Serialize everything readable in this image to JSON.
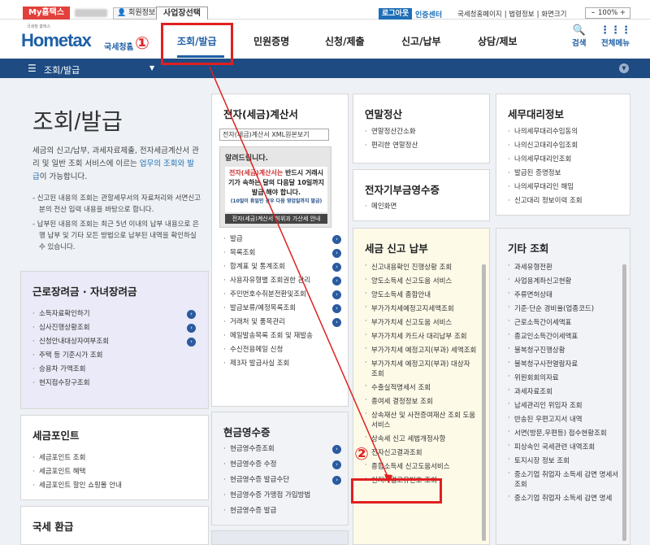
{
  "topbar": {
    "my_hometax": "My홈택스",
    "member_info": "회원정보",
    "business_select": "사업장선택",
    "logout": "로그아웃",
    "cert_center": "인증센터",
    "links": [
      "국세청홈페이지",
      "법령정보",
      "화면크기"
    ],
    "zoom": "100%"
  },
  "header": {
    "logo_sub": "국세청 홈택스",
    "logo": "Hometax",
    "agency": "국세청홈택스",
    "nav": [
      "조회/발급",
      "민원증명",
      "신청/제출",
      "신고/납부",
      "상담/제보"
    ],
    "search": "검색",
    "allmenu": "전체메뉴"
  },
  "breadcrumb": {
    "title": "조회/발급"
  },
  "intro": {
    "title": "조회/발급",
    "desc_pre": "세금의 신고/납부, 과세자료제출, 전자세금계산서 관리 및 일반 조회 서비스에 이르는 ",
    "desc_hl": "업무의 조회와 발급",
    "desc_post": "이 가능합니다.",
    "notes": [
      "- 신고된 내용의 조회는 관할세무서의 자료처리와 서면신고분의 전산 입력 내용을 바탕으로 합니다.",
      "- 납부된 내용의 조회는 최근 5년 이내의 납부 내용으로 은행 납부 및 기타 모든 방법으로 납부된 내역을 확인하실 수 있습니다."
    ]
  },
  "boxes": {
    "labor": {
      "title": "근로장려금 · 자녀장려금",
      "items": [
        "소득자료확인하기",
        "심사진행상황조회",
        "신청안내대상자여부조회",
        "주택 등 기준시가 조회",
        "승용차 가액조회",
        "현지접수장구조회"
      ]
    },
    "point": {
      "title": "세금포인트",
      "items": [
        "세금포인트 조회",
        "세금포인트 혜택",
        "세금포인트 할인 쇼핑몰 안내"
      ]
    },
    "refund": {
      "title": "국세 환급"
    },
    "einvoice": {
      "title": "전자(세금)계산서",
      "xml": "전자(세금)계산서 XML원본보기",
      "notice_title": "알려드립니다.",
      "notice_body_1": "전자(세금)계산서는",
      "notice_body_2": "반드시 거래시기가 속하는 달의 다음달 10일까지 발급 해야 합니다.",
      "notice_small": "(10일이 휴일인 경우 다음 영업일까지 발급)",
      "notice_bar": "전자(세금)계산서 허위과 가산세 안내",
      "items": [
        "발급",
        "목록조회",
        "합계표 및 통계조회",
        "사용자유형별 조회권한 관리",
        "주민번호수취분전환및조회",
        "발급보류/예정목록조회",
        "거래처 및 품목관리",
        "메일발송목록 조회 및 재발송",
        "수신전용메일 신청",
        "제3자 발급사실 조회"
      ]
    },
    "cash": {
      "title": "현금영수증",
      "items": [
        "현금영수증조회",
        "현금영수증 수정",
        "현금영수증 발급수단",
        "현금영수증 가맹점 가입방법",
        "현금영수증 발급"
      ]
    },
    "yearend": {
      "title": "연말정산",
      "items": [
        "연말정산간소화",
        "편리한 연말정산"
      ]
    },
    "donation": {
      "title": "전자기부금영수증",
      "items": [
        "메인화면"
      ]
    },
    "taxfiling": {
      "title": "세금 신고 납부",
      "items": [
        "신고내용확인 진행상황 조회",
        "양도소득세 신고도움 서비스",
        "양도소득세 종합안내",
        "부가가치세예정고지세액조회",
        "부가가치세 신고도움 서비스",
        "부가가치세 카드사 대리납부 조회",
        "부가가치세 예정고지(부과) 세액조회",
        "부가가치세 예정고지(부과) 대상자 조회",
        "수출실적명세서 조회",
        "종여세 결정정보 조회",
        "상속재산 및 사전증여재산 조회 도움서비스",
        "상속세 신고 세법개정사항",
        "전자신고결과조회",
        "종합소득세 신고도움서비스",
        "현지기업고유번호 조회"
      ]
    },
    "agent": {
      "title": "세무대리정보",
      "items": [
        "나의세무대리수임동의",
        "나의신고대리수임조회",
        "나의세무대리인조회",
        "발급된 증명정보",
        "나의세무대리인 해임",
        "신고대리 정보이력 조회"
      ]
    },
    "other": {
      "title": "기타 조회",
      "items": [
        "과세유형전환",
        "사업용계좌신고현황",
        "주류면허상태",
        "기준·단순 경비율(업종코드)",
        "근로소득간이세액표",
        "종교인소득간이세액표",
        "불복청구진행상황",
        "불복청구사전열람자료",
        "위원회회의자료",
        "과세자료조회",
        "납세관리인 위임자 조회",
        "반송된 우편고지서 내역",
        "서면(방문,우편등) 접수현황조회",
        "피상속인 국세관련 내역조회",
        "토지시장 정보 조회",
        "중소기업 취업자 소득세 감면 명세서 조회",
        "중소기업 취업자 소득세 감면 명세"
      ]
    }
  },
  "annotations": {
    "one": "①",
    "two": "②"
  },
  "colors": {
    "brand": "#1f5fa5",
    "bar": "#1e4b82",
    "highlight": "#e02020"
  }
}
